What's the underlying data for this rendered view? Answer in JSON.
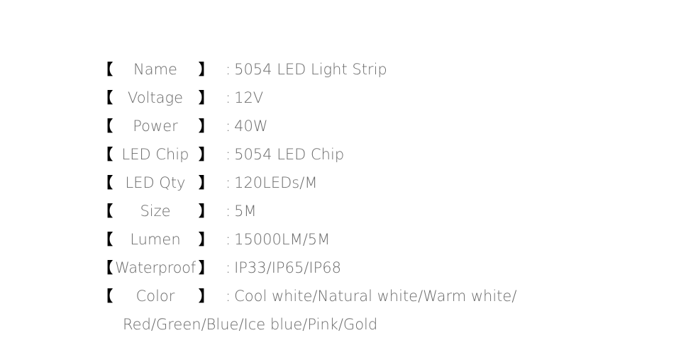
{
  "document": {
    "type": "product-specification-list",
    "background_color": "#ffffff",
    "label_color": "#6b6b6b",
    "value_color": "#6b6b6b",
    "bracket_color": "#000000",
    "bracket_open": "【",
    "bracket_close": "】",
    "separator": ":"
  },
  "specs": [
    {
      "label": "Name",
      "value": "5054 LED Light Strip"
    },
    {
      "label": "Voltage",
      "value": "12V"
    },
    {
      "label": "Power",
      "value": "40W"
    },
    {
      "label": "LED Chip",
      "value": "5054 LED Chip"
    },
    {
      "label": "LED Qty",
      "value": "120LEDs/M"
    },
    {
      "label": "Size",
      "value": "5M"
    },
    {
      "label": "Lumen",
      "value": "15000LM/5M"
    },
    {
      "label": "Waterproof",
      "value": "IP33/IP65/IP68"
    },
    {
      "label": "Color",
      "value": "Cool white/Natural white/Warm white/",
      "value_line2": "Red/Green/Blue/Ice blue/Pink/Gold"
    }
  ]
}
